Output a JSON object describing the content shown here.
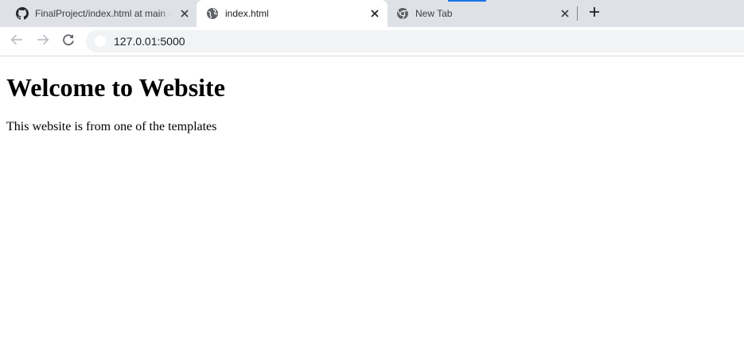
{
  "browser": {
    "tabs": [
      {
        "title": "FinalProject/index.html at main · ",
        "icon": "github-icon",
        "active": false
      },
      {
        "title": "index.html",
        "icon": "globe-icon",
        "active": true
      },
      {
        "title": "New Tab",
        "icon": "chrome-icon",
        "active": false
      }
    ],
    "address_bar": {
      "url": "127.0.01:5000"
    }
  },
  "page": {
    "heading": "Welcome to Website",
    "paragraph": "This website is from one of the templates"
  },
  "colors": {
    "tabstrip_bg": "#dee1e6",
    "active_tab_bg": "#ffffff",
    "omnibox_bg": "#f1f3f4",
    "icon_gray": "#5f6368",
    "accent_blue": "#1a73e8"
  }
}
